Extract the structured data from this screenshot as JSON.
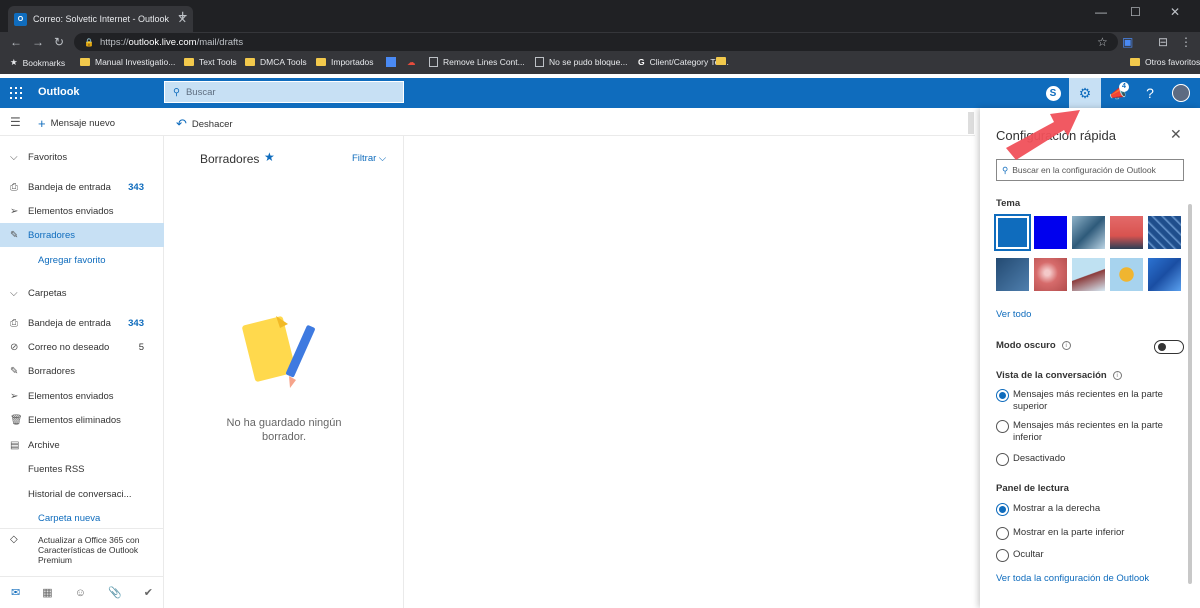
{
  "browser": {
    "tab_title": "Correo: Solvetic Internet - Outlook",
    "tab_favicon": "O",
    "url_prefix": "https://",
    "url_domain": "outlook.live.com",
    "url_path": "/mail/drafts",
    "bookmarks": [
      {
        "label": "Bookmarks",
        "icon": "star-icon"
      },
      {
        "label": "Manual Investigatio...",
        "icon": "folder-icon"
      },
      {
        "label": "Text Tools",
        "icon": "folder-icon"
      },
      {
        "label": "DMCA Tools",
        "icon": "folder-icon"
      },
      {
        "label": "Importados",
        "icon": "folder-icon"
      },
      {
        "label": "",
        "icon": "calendar-icon"
      },
      {
        "label": "",
        "icon": "cloud-icon"
      },
      {
        "label": "Remove Lines Cont...",
        "icon": "page-icon"
      },
      {
        "label": "No se pudo bloque...",
        "icon": "page-icon"
      },
      {
        "label": "Client/Category Ter...",
        "icon": "google-icon"
      },
      {
        "label": "",
        "icon": "folder-icon"
      },
      {
        "label": "Otros favoritos",
        "icon": "folder-icon"
      }
    ]
  },
  "header": {
    "app_name": "Outlook",
    "search_placeholder": "Buscar",
    "notification_count": "4"
  },
  "toolbar": {
    "new_message": "Mensaje nuevo",
    "undo": "Deshacer"
  },
  "sidebar": {
    "favorites_header": "Favoritos",
    "favorites": [
      {
        "label": "Bandeja de entrada",
        "count": "343",
        "icon": "inbox-icon"
      },
      {
        "label": "Elementos enviados",
        "count": "",
        "icon": "send-icon"
      },
      {
        "label": "Borradores",
        "count": "",
        "icon": "pencil-icon"
      }
    ],
    "add_favorite": "Agregar favorito",
    "folders_header": "Carpetas",
    "folders": [
      {
        "label": "Bandeja de entrada",
        "count": "343",
        "icon": "inbox-icon"
      },
      {
        "label": "Correo no deseado",
        "count": "5",
        "icon": "block-icon"
      },
      {
        "label": "Borradores",
        "count": "",
        "icon": "pencil-icon"
      },
      {
        "label": "Elementos enviados",
        "count": "",
        "icon": "send-icon"
      },
      {
        "label": "Elementos eliminados",
        "count": "",
        "icon": "trash-icon"
      },
      {
        "label": "Archive",
        "count": "",
        "icon": "archive-icon"
      },
      {
        "label": "Fuentes RSS",
        "count": "",
        "icon": ""
      },
      {
        "label": "Historial de conversaci...",
        "count": "",
        "icon": ""
      }
    ],
    "new_folder": "Carpeta nueva",
    "upgrade_text": "Actualizar a Office 365 con Características de Outlook Premium"
  },
  "message_list": {
    "title": "Borradores",
    "filter": "Filtrar",
    "empty_text": "No ha guardado ningún borrador."
  },
  "quick_settings": {
    "title": "Configuración rápida",
    "search_placeholder": "Buscar en la configuración de Outlook",
    "theme_header": "Tema",
    "see_all": "Ver todo",
    "dark_mode": "Modo oscuro",
    "dark_mode_on": false,
    "conversation_header": "Vista de la conversación",
    "conversation_options": [
      {
        "label": "Mensajes más recientes en la parte superior",
        "selected": true
      },
      {
        "label": "Mensajes más recientes en la parte inferior",
        "selected": false
      },
      {
        "label": "Desactivado",
        "selected": false
      }
    ],
    "reading_header": "Panel de lectura",
    "reading_options": [
      {
        "label": "Mostrar a la derecha",
        "selected": true
      },
      {
        "label": "Mostrar en la parte inferior",
        "selected": false
      },
      {
        "label": "Ocultar",
        "selected": false
      }
    ],
    "all_settings": "Ver toda la configuración de Outlook"
  },
  "colors": {
    "outlook_blue": "#0f6cbd",
    "selected_bg": "#c7e0f4",
    "arrow_red": "#f0505a"
  }
}
